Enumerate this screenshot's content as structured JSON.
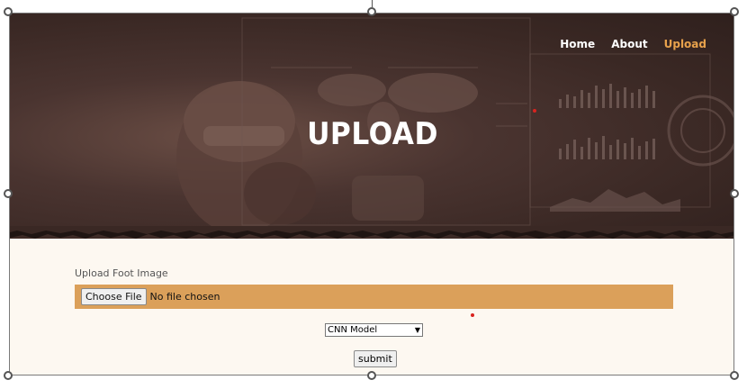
{
  "nav": {
    "items": [
      {
        "label": "Home",
        "active": false
      },
      {
        "label": "About",
        "active": false
      },
      {
        "label": "Upload",
        "active": true
      }
    ]
  },
  "hero": {
    "title": "UPLOAD"
  },
  "form": {
    "upload_label": "Upload Foot Image",
    "file_button": "Choose File",
    "file_status": "No file chosen",
    "model_selected": "CNN Model",
    "submit_label": "submit"
  },
  "colors": {
    "accent": "#e8a24c",
    "file_bar": "#dba05a",
    "hero_bg": "#3a2824",
    "page_bg": "#fdf8f1",
    "marker": "#d9231f"
  }
}
